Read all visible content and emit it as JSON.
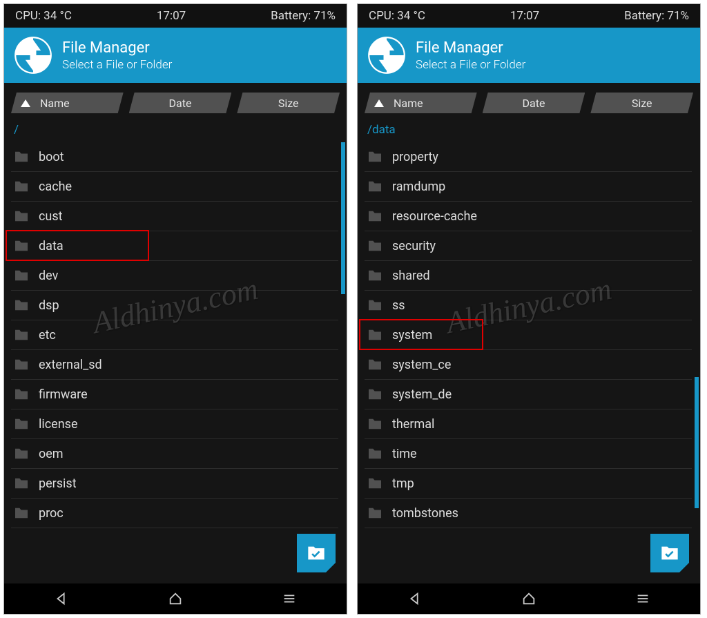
{
  "status": {
    "cpu": "CPU: 34 °C",
    "time": "17:07",
    "battery": "Battery: 71%"
  },
  "header": {
    "title": "File Manager",
    "subtitle": "Select a File or Folder"
  },
  "sort": {
    "name": "Name",
    "date": "Date",
    "size": "Size"
  },
  "watermark": "Aldhinya.com",
  "left": {
    "path": "/",
    "items": [
      "boot",
      "cache",
      "cust",
      "data",
      "dev",
      "dsp",
      "etc",
      "external_sd",
      "firmware",
      "license",
      "oem",
      "persist",
      "proc"
    ],
    "highlight_index": 3
  },
  "right": {
    "path": "/data",
    "items": [
      "property",
      "ramdump",
      "resource-cache",
      "security",
      "shared",
      "ss",
      "system",
      "system_ce",
      "system_de",
      "thermal",
      "time",
      "tmp",
      "tombstones"
    ],
    "highlight_index": 6
  }
}
